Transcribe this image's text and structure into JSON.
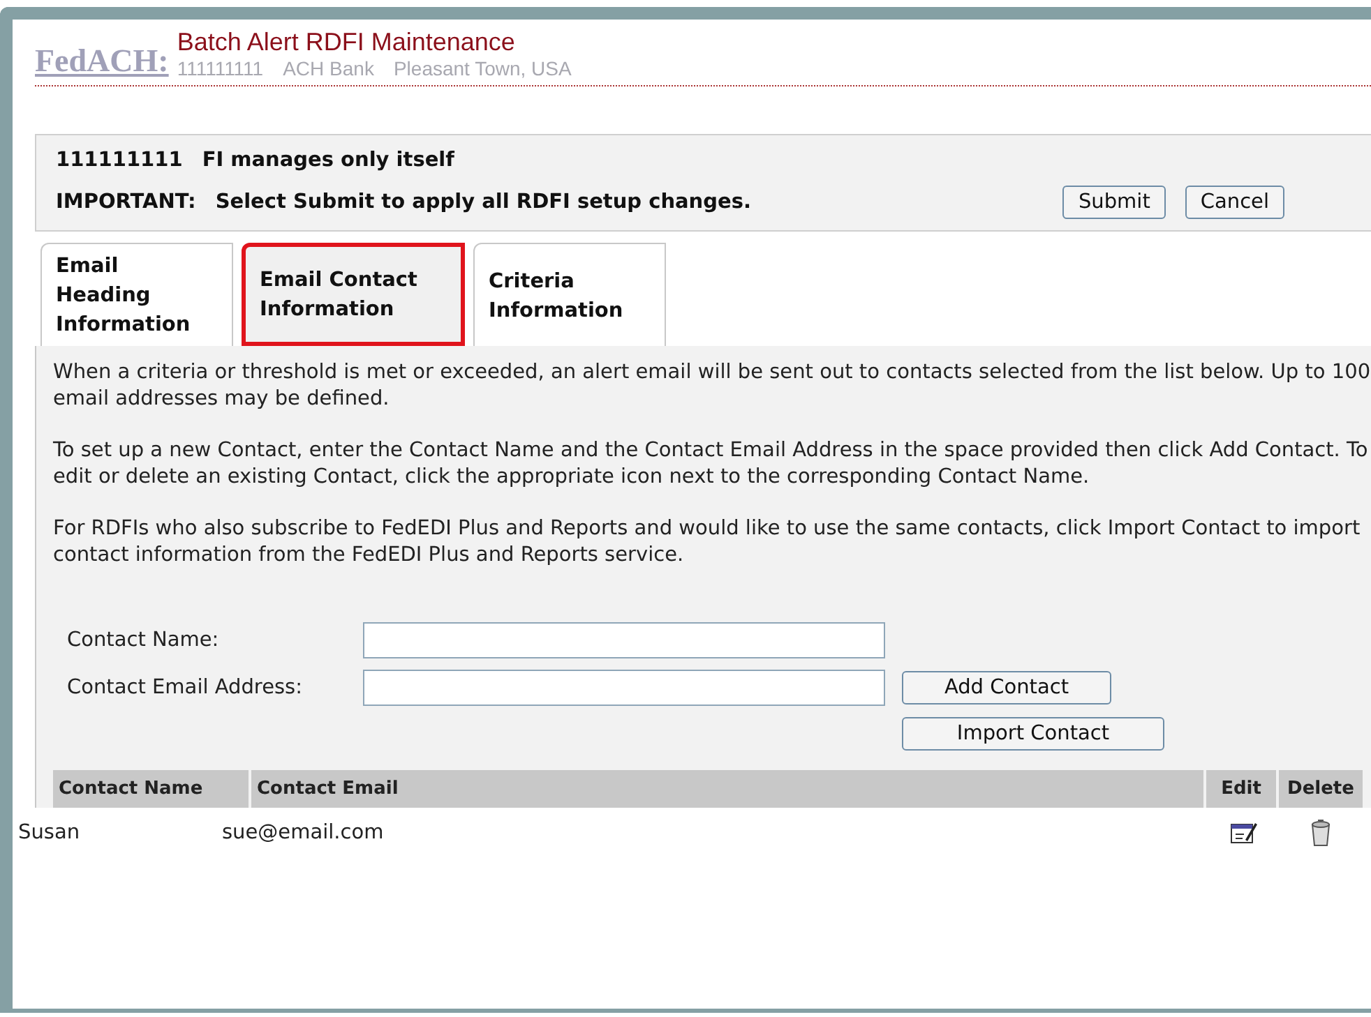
{
  "header": {
    "brand": "FedACH:",
    "title": "Batch Alert RDFI Maintenance",
    "routing": "111111111",
    "bank": "ACH Bank",
    "location": "Pleasant Town, USA"
  },
  "summary": {
    "routing": "111111111",
    "management": "FI manages only itself",
    "important_label": "IMPORTANT:",
    "important_text": "Select Submit to apply all RDFI setup changes.",
    "buttons": [
      "Submit",
      "Cancel"
    ]
  },
  "tabs": [
    {
      "label": "Email Heading Information",
      "selected": false
    },
    {
      "label": "Email Contact Information",
      "selected": true
    },
    {
      "label": "Criteria Information",
      "selected": false
    }
  ],
  "paragraphs": [
    "When a criteria or threshold is met or exceeded, an alert email will be sent out to contacts selected from the list below. Up to 100 email addresses may be defined.",
    "To set up a new Contact, enter the Contact Name and the Contact Email Address in the space provided then click Add Contact. To edit or delete an existing Contact, click the appropriate icon next to the corresponding Contact Name.",
    "For RDFIs who also subscribe to FedEDI Plus and Reports and would like to use the same contacts, click Import Contact to import contact information from the FedEDI Plus and Reports service."
  ],
  "form": {
    "name_label": "Contact Name:",
    "email_label": "Contact Email Address:",
    "add_button": "Add Contact",
    "import_button": "Import Contact"
  },
  "table": {
    "columns": [
      "Contact Name",
      "Contact Email",
      "Edit",
      "Delete"
    ],
    "rows": [
      {
        "name": "Susan",
        "email": "sue@email.com"
      }
    ]
  }
}
